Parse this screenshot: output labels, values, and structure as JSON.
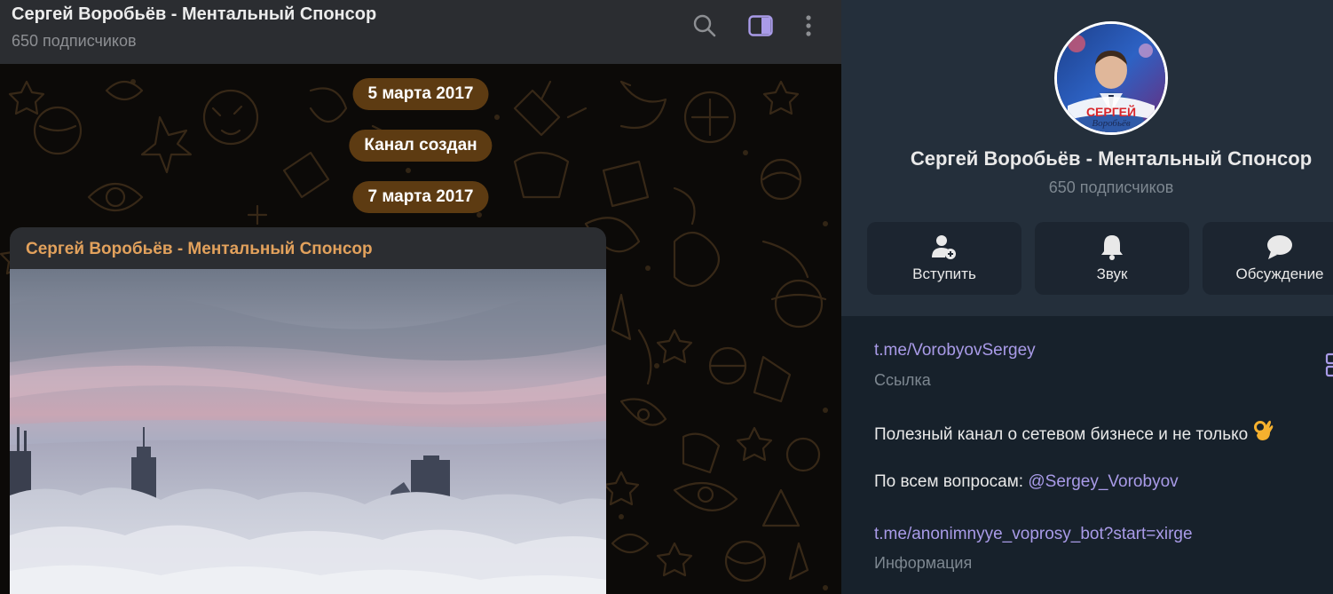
{
  "header": {
    "title": "Сергей Воробьёв - Ментальный Спонсор",
    "subtitle": "650 подписчиков",
    "icons": [
      "search-icon",
      "sidebar-toggle-icon",
      "more-vertical-icon"
    ]
  },
  "chat": {
    "service_messages": [
      "5 марта 2017",
      "Канал создан",
      "7 марта 2017"
    ],
    "post": {
      "author": "Сергей Воробьёв - Ментальный Спонсор"
    }
  },
  "info": {
    "avatar_text": [
      "СЕРГЕЙ",
      "Воробьёв"
    ],
    "name": "Сергей Воробьёв - Ментальный Спонсор",
    "subscribers": "650 подписчиков",
    "actions": [
      {
        "label": "Вступить",
        "icon": "add-user-icon"
      },
      {
        "label": "Звук",
        "icon": "bell-icon"
      },
      {
        "label": "Обсуждение",
        "icon": "chat-bubble-icon"
      }
    ],
    "link": {
      "value": "t.me/VorobyovSergey",
      "caption": "Ссылка"
    },
    "description": "Полезный канал  о сетевом бизнесе и не только",
    "description_emoji": "ok-hand-emoji",
    "contact_prefix": "По всем вопросам: ",
    "contact_mention": "@Sergey_Vorobyov",
    "bot_link": {
      "value": "t.me/anonimnyye_voprosy_bot?start=xirge",
      "caption": "Информация"
    }
  },
  "colors": {
    "accent": "#a99be8",
    "author": "#e2a15c",
    "service_bubble": "#5d3b12",
    "panel": "#242f3b",
    "header": "#2b2d31"
  }
}
